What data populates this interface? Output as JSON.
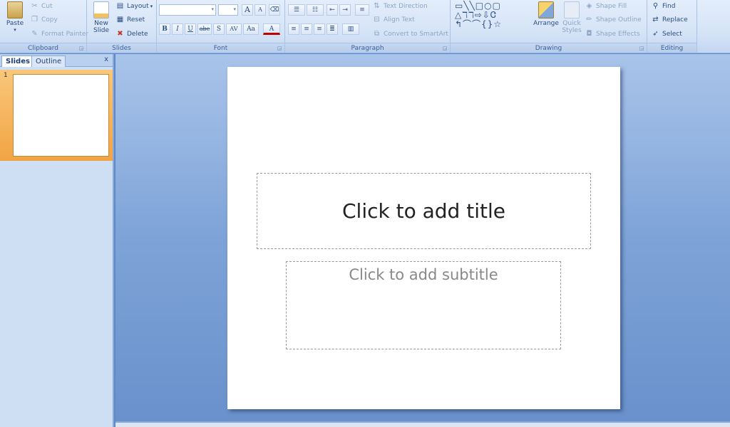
{
  "ribbon": {
    "clipboard": {
      "label": "Clipboard",
      "paste": "Paste",
      "cut": "Cut",
      "copy": "Copy",
      "format_painter": "Format Painter"
    },
    "slides": {
      "label": "Slides",
      "new_slide": "New Slide",
      "layout": "Layout",
      "reset": "Reset",
      "delete": "Delete"
    },
    "font": {
      "label": "Font",
      "font_name": "",
      "font_size": "",
      "grow": "A",
      "shrink": "A",
      "bold": "B",
      "italic": "I",
      "underline": "U",
      "strike": "abe",
      "shadow": "S",
      "spacing": "AV",
      "case": "Aa",
      "color": "A"
    },
    "paragraph": {
      "label": "Paragraph",
      "text_direction": "Text Direction",
      "align_text": "Align Text",
      "convert_smartart": "Convert to SmartArt"
    },
    "drawing": {
      "label": "Drawing",
      "shapes_row1": "▭╲╲□○▢",
      "shapes_row2": "△ℸℸ⇨⇩Ꮳ",
      "shapes_row3": "↰⌒⌒{}☆",
      "arrange": "Arrange",
      "quick_styles": "Quick Styles",
      "shape_fill": "Shape Fill",
      "shape_outline": "Shape Outline",
      "shape_effects": "Shape Effects"
    },
    "editing": {
      "label": "Editing",
      "find": "Find",
      "replace": "Replace",
      "select": "Select"
    }
  },
  "pane": {
    "tab_slides": "Slides",
    "tab_outline": "Outline",
    "close": "x",
    "thumbnails": [
      {
        "number": "1"
      }
    ]
  },
  "slide": {
    "title_placeholder": "Click to add title",
    "subtitle_placeholder": "Click to add subtitle"
  }
}
